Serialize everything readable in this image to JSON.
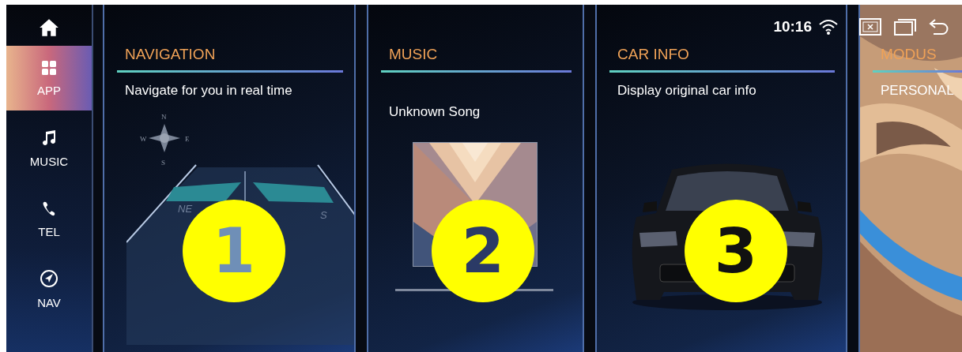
{
  "status_bar": {
    "time": "10:16"
  },
  "sidebar": {
    "items": [
      {
        "label": "APP",
        "kind": "apps",
        "selected": true
      },
      {
        "label": "MUSIC",
        "kind": "music",
        "selected": false
      },
      {
        "label": "TEL",
        "kind": "phone",
        "selected": false
      },
      {
        "label": "NAV",
        "kind": "nav",
        "selected": false
      }
    ]
  },
  "cards": [
    {
      "kind": "navigation",
      "title": "NAVIGATION",
      "subtitle": "Navigate for you in real time",
      "compass": [
        "N",
        "W",
        "E",
        "S"
      ],
      "road_labels": [
        "NE",
        "S"
      ]
    },
    {
      "kind": "music",
      "title": "MUSIC",
      "song": "Unknown Song"
    },
    {
      "kind": "car",
      "title": "CAR INFO",
      "subtitle": "Display original car info"
    },
    {
      "kind": "mode",
      "title": "MODUS",
      "subtitle": "PERSONAL"
    }
  ],
  "callouts": [
    "1",
    "2",
    "3"
  ]
}
